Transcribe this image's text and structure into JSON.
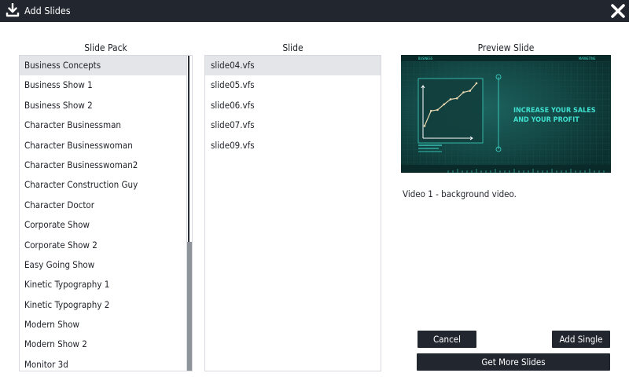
{
  "window": {
    "title": "Add Slides",
    "title_icon": "download-icon",
    "close_icon": "close-icon"
  },
  "columns": {
    "pack": "Slide Pack",
    "slide": "Slide",
    "preview": "Preview Slide"
  },
  "slide_packs": [
    "Business Concepts",
    "Business Show 1",
    "Business Show 2",
    "Character Businessman",
    "Character Businesswoman",
    "Character Businesswoman2",
    "Character Construction Guy",
    "Character Doctor",
    "Corporate Show",
    "Corporate Show 2",
    "Easy Going Show",
    "Kinetic Typography 1",
    "Kinetic Typography 2",
    "Modern Show",
    "Modern Show 2",
    "Monitor 3d"
  ],
  "selected_pack": "Business Concepts",
  "slides": [
    "slide04.vfs",
    "slide05.vfs",
    "slide06.vfs",
    "slide07.vfs",
    "slide09.vfs"
  ],
  "selected_slide": "slide04.vfs",
  "preview": {
    "headline_line1": "INCREASE YOUR SALES",
    "headline_line2": "AND YOUR PROFIT",
    "corner_left": "BUSINESS",
    "corner_right": "MARKETING",
    "chart_values": [
      0.15,
      0.45,
      0.47,
      0.58,
      0.68,
      0.7,
      0.82,
      0.85,
      1.0
    ],
    "colors": {
      "background": "#0f3d3b",
      "accent": "#3fe0d0",
      "line": "#e8d8b0"
    }
  },
  "description": "Video 1 - background video.",
  "buttons": {
    "cancel": "Cancel",
    "add_single": "Add Single",
    "get_more": "Get More Slides"
  },
  "colors": {
    "titlebar": "#22262f",
    "selected_row": "#e4e5e9",
    "button": "#22262f"
  }
}
